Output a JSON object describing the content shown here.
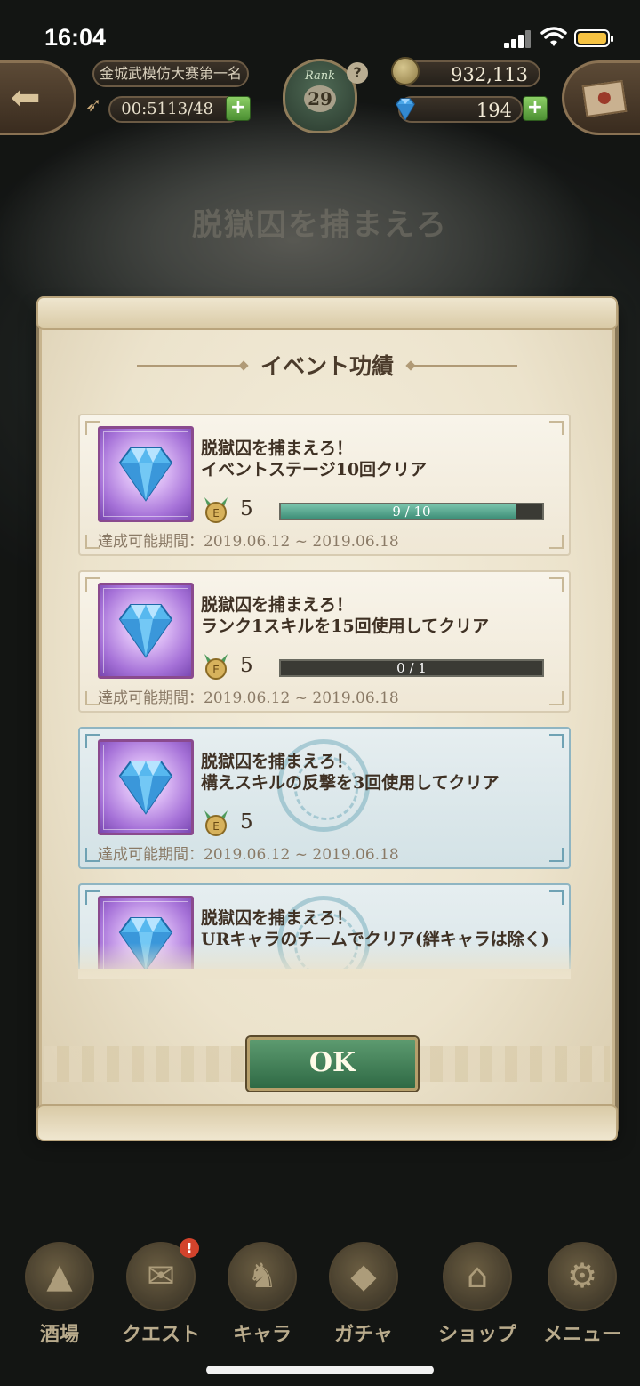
{
  "status_bar": {
    "time": "16:04"
  },
  "hud": {
    "title": "金城武模仿大赛第一名",
    "stamina": "00:5113/48",
    "rank_label": "Rank",
    "rank": "29",
    "gold": "932,113",
    "gems": "194"
  },
  "background": {
    "stage_title": "脱獄囚を捕まえろ"
  },
  "dialog": {
    "title": "イベント功績",
    "ok_label": "OK",
    "achievements": [
      {
        "line1": "脱獄囚を捕まえろ！",
        "line2": "イベントステージ10回クリア",
        "reward": "5",
        "progress_text": "9 / 10",
        "progress": 0.9,
        "completed": false,
        "period": "達成可能期間：2019.06.12 ~ 2019.06.18"
      },
      {
        "line1": "脱獄囚を捕まえろ！",
        "line2": "ランク1スキルを15回使用してクリア",
        "reward": "5",
        "progress_text": "0 / 1",
        "progress": 0,
        "completed": false,
        "period": "達成可能期間：2019.06.12 ~ 2019.06.18"
      },
      {
        "line1": "脱獄囚を捕まえろ！",
        "line2": "構えスキルの反撃を3回使用してクリア",
        "reward": "5",
        "completed": true,
        "period": "達成可能期間：2019.06.12 ~ 2019.06.18"
      },
      {
        "line1": "脱獄囚を捕まえろ！",
        "line2": "URキャラのチームでクリア(絆キャラは除く)",
        "completed": true
      }
    ]
  },
  "bottom_nav": [
    {
      "label": "酒場",
      "icon": "tavern-icon"
    },
    {
      "label": "クエスト",
      "icon": "quest-scroll-icon",
      "alert": "!"
    },
    {
      "label": "キャラ",
      "icon": "helmet-icon"
    },
    {
      "label": "ガチャ",
      "icon": "crystal-icon"
    },
    {
      "label": "ショップ",
      "icon": "shop-sign-icon"
    },
    {
      "label": "メニュー",
      "icon": "gear-icon"
    }
  ],
  "colors": {
    "progress_fill": "#4fa58a",
    "ok_button": "#3f7d55",
    "item_frame": "#8a4a8e"
  }
}
